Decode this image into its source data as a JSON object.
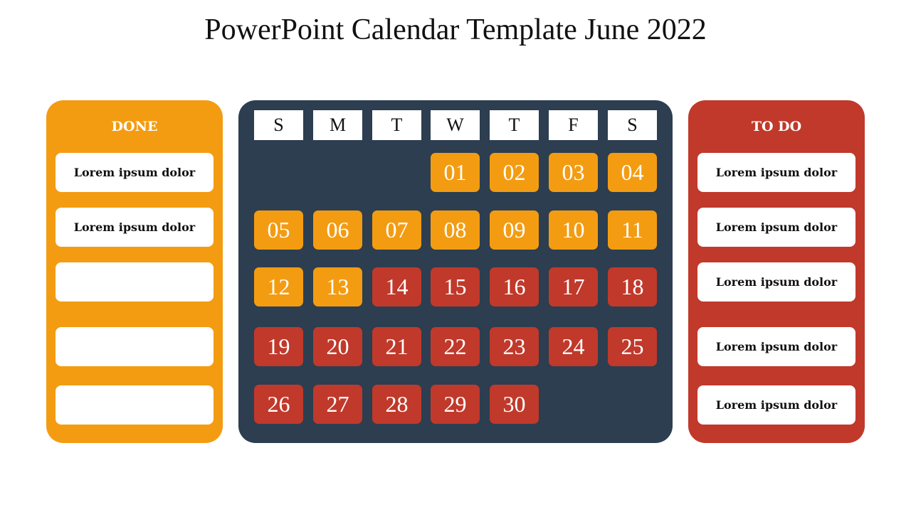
{
  "title": "PowerPoint Calendar Template June 2022",
  "colors": {
    "done": "#F39C12",
    "todo": "#C0392B",
    "calendar_bg": "#2C3E50"
  },
  "done_panel": {
    "heading": "DONE",
    "items": [
      "Lorem ipsum dolor",
      "Lorem ipsum dolor",
      "",
      "",
      ""
    ]
  },
  "todo_panel": {
    "heading": "TO DO",
    "items": [
      "Lorem ipsum dolor",
      "Lorem ipsum dolor",
      "Lorem ipsum dolor",
      "Lorem ipsum dolor",
      "Lorem ipsum dolor"
    ]
  },
  "calendar": {
    "month": "June 2022",
    "weekdays": [
      "S",
      "M",
      "T",
      "W",
      "T",
      "F",
      "S"
    ],
    "first_weekday_index": 3,
    "days": [
      {
        "label": "01",
        "status": "done"
      },
      {
        "label": "02",
        "status": "done"
      },
      {
        "label": "03",
        "status": "done"
      },
      {
        "label": "04",
        "status": "done"
      },
      {
        "label": "05",
        "status": "done"
      },
      {
        "label": "06",
        "status": "done"
      },
      {
        "label": "07",
        "status": "done"
      },
      {
        "label": "08",
        "status": "done"
      },
      {
        "label": "09",
        "status": "done"
      },
      {
        "label": "10",
        "status": "done"
      },
      {
        "label": "11",
        "status": "done"
      },
      {
        "label": "12",
        "status": "done"
      },
      {
        "label": "13",
        "status": "done"
      },
      {
        "label": "14",
        "status": "todo"
      },
      {
        "label": "15",
        "status": "todo"
      },
      {
        "label": "16",
        "status": "todo"
      },
      {
        "label": "17",
        "status": "todo"
      },
      {
        "label": "18",
        "status": "todo"
      },
      {
        "label": "19",
        "status": "todo"
      },
      {
        "label": "20",
        "status": "todo"
      },
      {
        "label": "21",
        "status": "todo"
      },
      {
        "label": "22",
        "status": "todo"
      },
      {
        "label": "23",
        "status": "todo"
      },
      {
        "label": "24",
        "status": "todo"
      },
      {
        "label": "25",
        "status": "todo"
      },
      {
        "label": "26",
        "status": "todo"
      },
      {
        "label": "27",
        "status": "todo"
      },
      {
        "label": "28",
        "status": "todo"
      },
      {
        "label": "29",
        "status": "todo"
      },
      {
        "label": "30",
        "status": "todo"
      }
    ]
  }
}
